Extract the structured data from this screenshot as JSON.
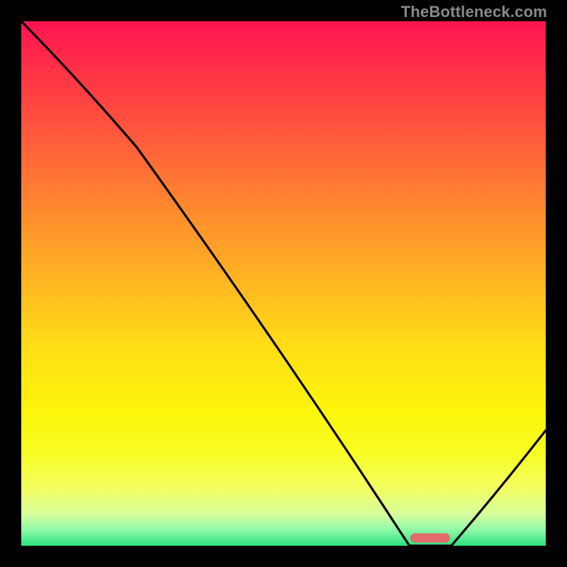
{
  "watermark": "TheBottleneck.com",
  "chart_data": {
    "type": "line",
    "title": "",
    "xlabel": "",
    "ylabel": "",
    "xlim": [
      0,
      100
    ],
    "ylim": [
      0,
      100
    ],
    "grid": false,
    "legend": false,
    "x": [
      0,
      22,
      74,
      82,
      100
    ],
    "values": [
      100,
      76,
      0,
      0,
      22
    ],
    "marker": {
      "x": 78,
      "y": 1.5,
      "shape": "pill",
      "color": "#e46a6b"
    }
  },
  "colors": {
    "background": "#000000",
    "curve": "#000000",
    "gradient_top": "#ff1452",
    "gradient_bottom": "#2be27d",
    "marker": "#e46a6b",
    "watermark": "#8a8a8a"
  }
}
